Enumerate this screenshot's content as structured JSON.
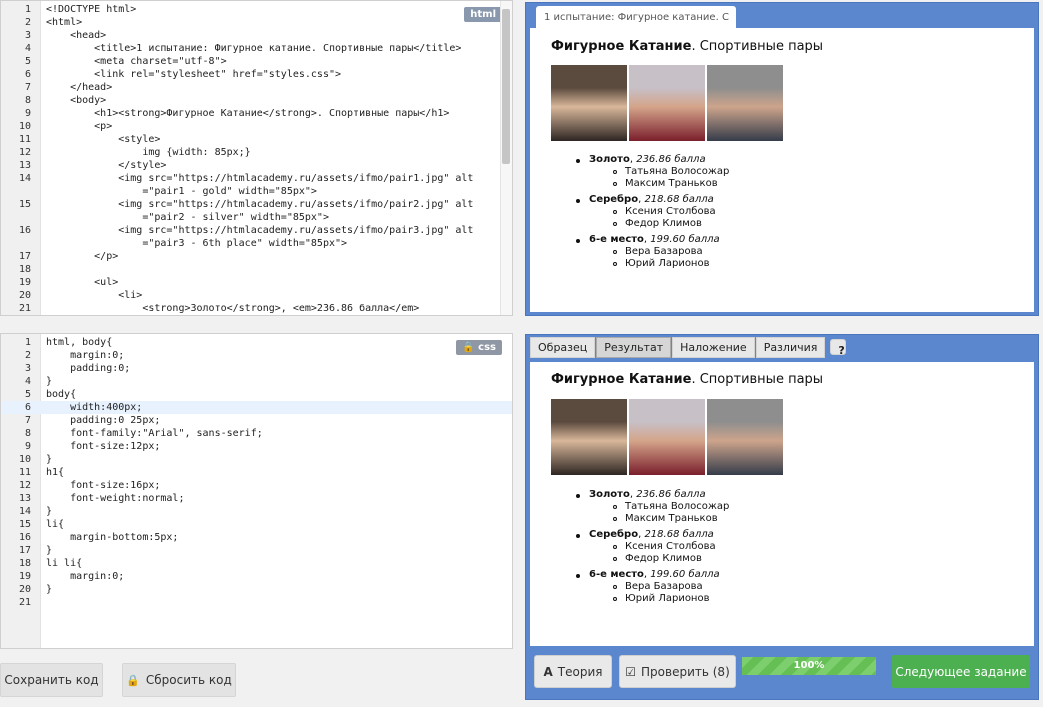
{
  "html_editor": {
    "lang": "html",
    "lines": [
      "<!DOCTYPE html>",
      "<html>",
      "    <head>",
      "        <title>1 испытание: Фигурное катание. Спортивные пары</title>",
      "        <meta charset=\"utf-8\">",
      "        <link rel=\"stylesheet\" href=\"styles.css\">",
      "    </head>",
      "    <body>",
      "        <h1><strong>Фигурное Катание</strong>. Спортивные пары</h1>",
      "        <p>",
      "            <style>",
      "                img {width: 85px;}",
      "            </style>",
      "            <img src=\"https://htmlacademy.ru/assets/ifmo/pair1.jpg\" alt",
      "                =\"pair1 - gold\" width=\"85px\">",
      "            <img src=\"https://htmlacademy.ru/assets/ifmo/pair2.jpg\" alt",
      "                =\"pair2 - silver\" width=\"85px\">",
      "            <img src=\"https://htmlacademy.ru/assets/ifmo/pair3.jpg\" alt",
      "                =\"pair3 - 6th place\" width=\"85px\">",
      "        </p>",
      "",
      "        <ul>",
      "            <li>",
      "                <strong>Золото</strong>, <em>236.86 балла</em>"
    ],
    "numbers": [
      "1",
      "2",
      "3",
      "4",
      "5",
      "6",
      "7",
      "8",
      "9",
      "10",
      "11",
      "12",
      "13",
      "14",
      "",
      "15",
      "",
      "16",
      "",
      "17",
      "18",
      "19",
      "20",
      "21"
    ]
  },
  "css_editor": {
    "lang": "css",
    "lines": [
      "html, body{",
      "    margin:0;",
      "    padding:0;",
      "}",
      "body{",
      "    width:400px;",
      "    padding:0 25px;",
      "    font-family:\"Arial\", sans-serif;",
      "    font-size:12px;",
      "}",
      "h1{",
      "    font-size:16px;",
      "    font-weight:normal;",
      "}",
      "li{",
      "    margin-bottom:5px;",
      "}",
      "li li{",
      "    margin:0;",
      "}",
      ""
    ]
  },
  "buttons": {
    "save": "Сохранить код",
    "reset": "Сбросить код",
    "theory": "Теория",
    "check": "Проверить (8)",
    "next": "Следующее задание",
    "progress": "100%"
  },
  "preview_tab": "1 испытание: Фигурное катание. С",
  "result_tabs": [
    "Образец",
    "Результат",
    "Наложение",
    "Различия"
  ],
  "help": "?",
  "page": {
    "h1_bold": "Фигурное Катание",
    "h1_rest": ". Спортивные пары",
    "items": [
      {
        "medal": "Золото",
        "score": "236.86 балла",
        "names": [
          "Татьяна Волосожар",
          "Максим Траньков"
        ]
      },
      {
        "medal": "Серебро",
        "score": "218.68 балла",
        "names": [
          "Ксения Столбова",
          "Федор Климов"
        ]
      },
      {
        "medal": "6-е место",
        "score": "199.60 балла",
        "names": [
          "Вера Базарова",
          "Юрий Ларионов"
        ]
      }
    ]
  }
}
